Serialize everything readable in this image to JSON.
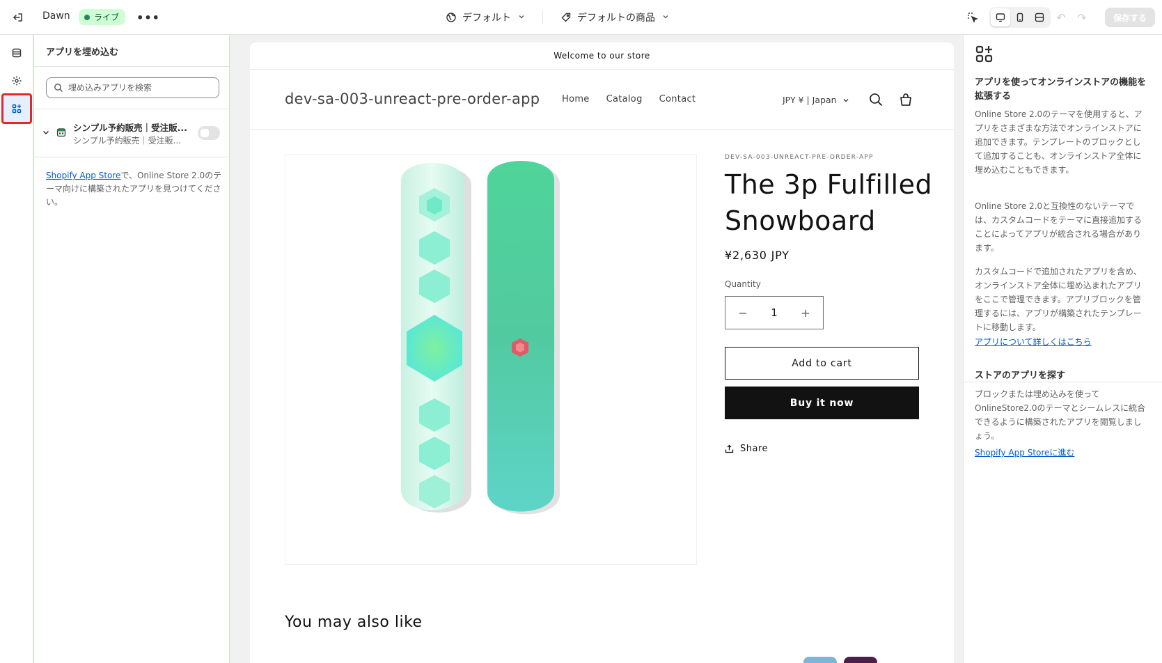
{
  "topbar": {
    "theme_name": "Dawn",
    "status_badge": "ライブ",
    "template_select": "デフォルト",
    "product_select": "デフォルトの商品",
    "save_label": "保存する"
  },
  "sidebar": {
    "title": "アプリを埋め込む",
    "search_placeholder": "埋め込みアプリを検索",
    "apps": [
      {
        "name": "シンプル予約販売｜受注販...",
        "subtitle": "シンプル予約販売｜受注販...",
        "enabled": false
      }
    ],
    "help_link": "Shopify App Store",
    "help_text": "で、Online Store 2.0のテーマ向けに構築されたアプリを見つけてください。"
  },
  "preview": {
    "announcement": "Welcome to our store",
    "store_name": "dev-sa-003-unreact-pre-order-app",
    "nav": [
      "Home",
      "Catalog",
      "Contact"
    ],
    "locale": "JPY ¥ | Japan",
    "vendor": "DEV-SA-003-UNREACT-PRE-ORDER-APP",
    "product_title": "The 3p Fulfilled Snowboard",
    "price": "¥2,630 JPY",
    "quantity_label": "Quantity",
    "quantity_value": "1",
    "add_to_cart": "Add to cart",
    "buy_now": "Buy it now",
    "share": "Share",
    "also_like": "You may also like"
  },
  "right_panel": {
    "heading1": "アプリを使ってオンラインストアの機能を拡張する",
    "para1": "Online Store 2.0のテーマを使用すると、アプリをさまざまな方法でオンラインストアに追加できます。テンプレートのブロックとして追加することも、オンラインストア全体に埋め込むこともできます。",
    "para2": "Online Store 2.0と互換性のないテーマでは、カスタムコードをテーマに直接追加することによってアプリが統合される場合があります。",
    "para3": "カスタムコードで追加されたアプリを含め、オンラインストア全体に埋め込まれたアプリをここで管理できます。アプリブロックを管理するには、アプリが構築されたテンプレートに移動します。",
    "link1": "アプリについて詳しくはこちら",
    "heading2": "ストアのアプリを探す",
    "para4": "ブロックまたは埋め込みを使ってOnlineStore2.0のテーマとシームレスに統合できるように構築されたアプリを閲覧しましょう。",
    "link2": "Shopify App Storeに進む"
  },
  "colors": {
    "badge_bg": "#cdfed4",
    "badge_dot": "#29845a",
    "link": "#005bd3",
    "highlight": "#e02a2a",
    "buy_button": "#121212"
  }
}
